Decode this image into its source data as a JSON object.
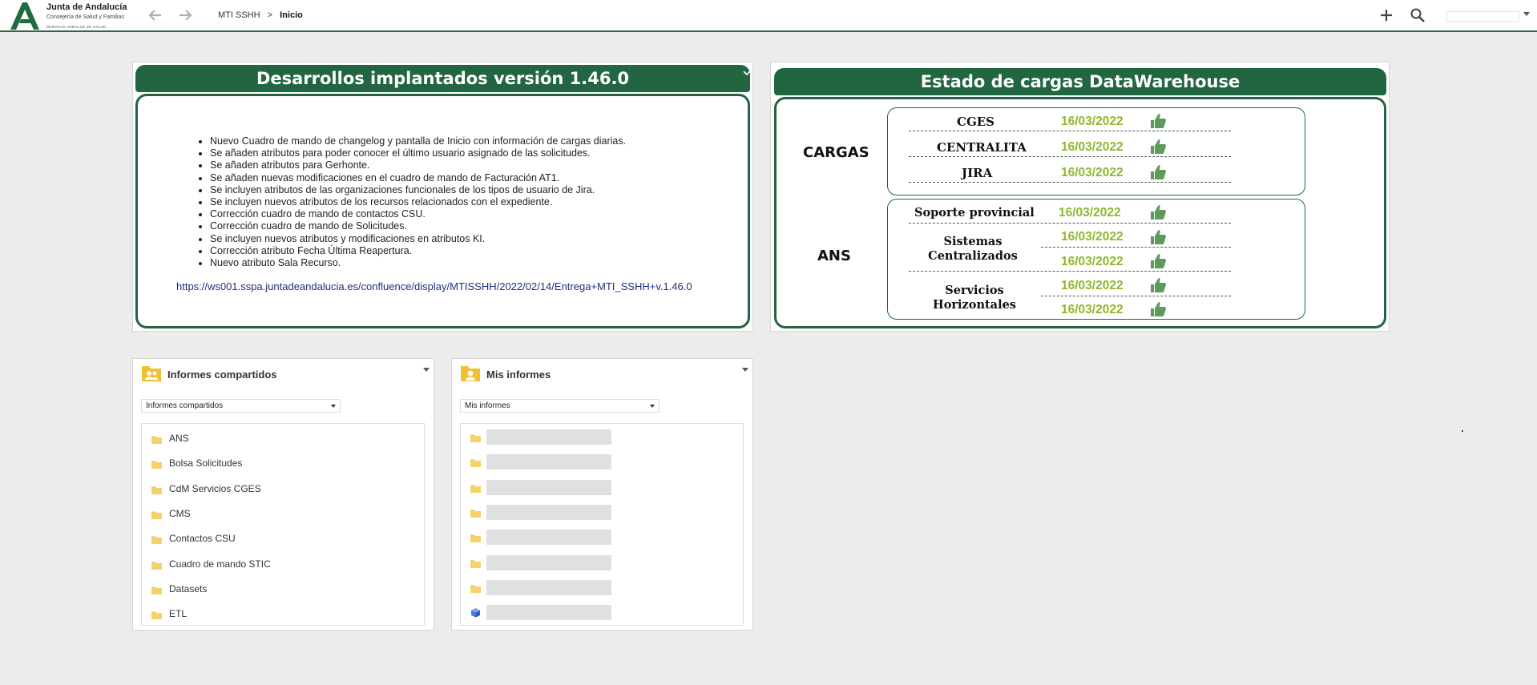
{
  "header": {
    "logo_title": "Junta de Andalucía",
    "logo_subtitle": "Consejería de Salud y Familias",
    "logo_subtitle2": "SERVICIO ANDALUZ DE SALUD",
    "breadcrumb": {
      "root": "MTI SSHH",
      "separator": ">",
      "current": "Inicio"
    },
    "user_name": ""
  },
  "developments": {
    "title": "Desarrollos implantados versión 1.46.0",
    "items": [
      "Nuevo Cuadro de mando de changelog y pantalla de Inicio con información de cargas diarias.",
      "Se añaden atributos para poder conocer el último usuario asignado de las solicitudes.",
      "Se añaden atributos para Gerhonte.",
      "Se añaden nuevas modificaciones en el cuadro de mando de Facturación AT1.",
      "Se incluyen atributos de las organizaciones funcionales de los tipos de usuario de Jira.",
      "Se incluyen nuevos atributos de los recursos relacionados con el expediente.",
      "Corrección cuadro de mando de contactos CSU.",
      "Corrección cuadro de mando de Solicitudes.",
      "Se incluyen nuevos atributos y modificaciones en atributos KI.",
      "Corrección atributo Fecha Última Reapertura.",
      "Nuevo atributo Sala Recurso."
    ],
    "link": "https://ws001.sspa.juntadeandalucia.es/confluence/display/MTISSHH/2022/02/14/Entrega+MTI_SSHH+v.1.46.0"
  },
  "dwh": {
    "title": "Estado de cargas DataWarehouse",
    "cargas_label": "CARGAS",
    "ans_label": "ANS",
    "cargas": [
      {
        "name": "CGES",
        "date": "16/03/2022",
        "status": "ok"
      },
      {
        "name": "CENTRALITA",
        "date": "16/03/2022",
        "status": "ok"
      },
      {
        "name": "JIRA",
        "date": "16/03/2022",
        "status": "ok"
      }
    ],
    "ans": [
      {
        "name": "Soporte provincial",
        "dates": [
          "16/03/2022"
        ]
      },
      {
        "name": "Sistemas Centralizados",
        "dates": [
          "16/03/2022",
          "16/03/2022"
        ]
      },
      {
        "name": "Servicios Horizontales",
        "dates": [
          "16/03/2022",
          "16/03/2022"
        ]
      }
    ],
    "status_color": "#8fb82a"
  },
  "shared_reports": {
    "title": "Informes compartidos",
    "selected": "Informes compartidos",
    "items": [
      "ANS",
      "Bolsa Solicitudes",
      "CdM Servicios CGES",
      "CMS",
      "Contactos CSU",
      "Cuadro de mando STIC",
      "Datasets",
      "ETL"
    ]
  },
  "my_reports": {
    "title": "Mis informes",
    "selected": "Mis informes",
    "items": [
      "",
      "",
      "",
      "",
      "",
      "",
      "",
      ""
    ]
  },
  "colors": {
    "brand_green": "#216641",
    "folder_yellow": "#f2c94c",
    "date_green": "#8fb82a"
  }
}
